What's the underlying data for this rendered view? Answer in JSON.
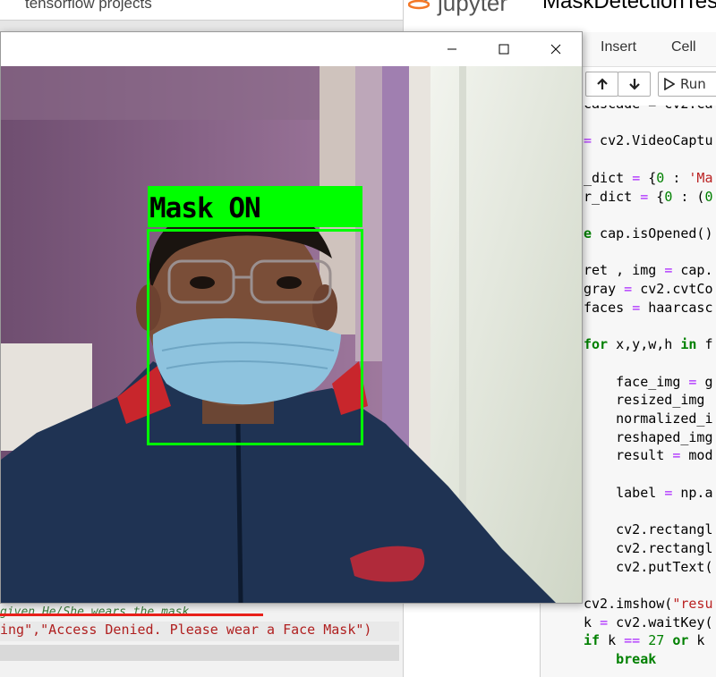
{
  "background_editor": {
    "search_text": "tensorflow projects",
    "comment_fragment": "given He/She wears the mask",
    "code_fragment": "ing\",\"Access Denied. Please wear a Face Mask\")"
  },
  "jupyter": {
    "brand": "jupyter",
    "notebook_title": "MaskDetectionTest",
    "menu": [
      "Insert",
      "Cell"
    ],
    "toolbar": {
      "up_icon": "arrow-up-icon",
      "down_icon": "arrow-down-icon",
      "run_label": "Run"
    },
    "colors": {
      "brand_orange": "#f37726",
      "keyword": "#008000"
    }
  },
  "video_window": {
    "detection": {
      "label": "Mask ON",
      "box_color": "#00ff00"
    }
  }
}
